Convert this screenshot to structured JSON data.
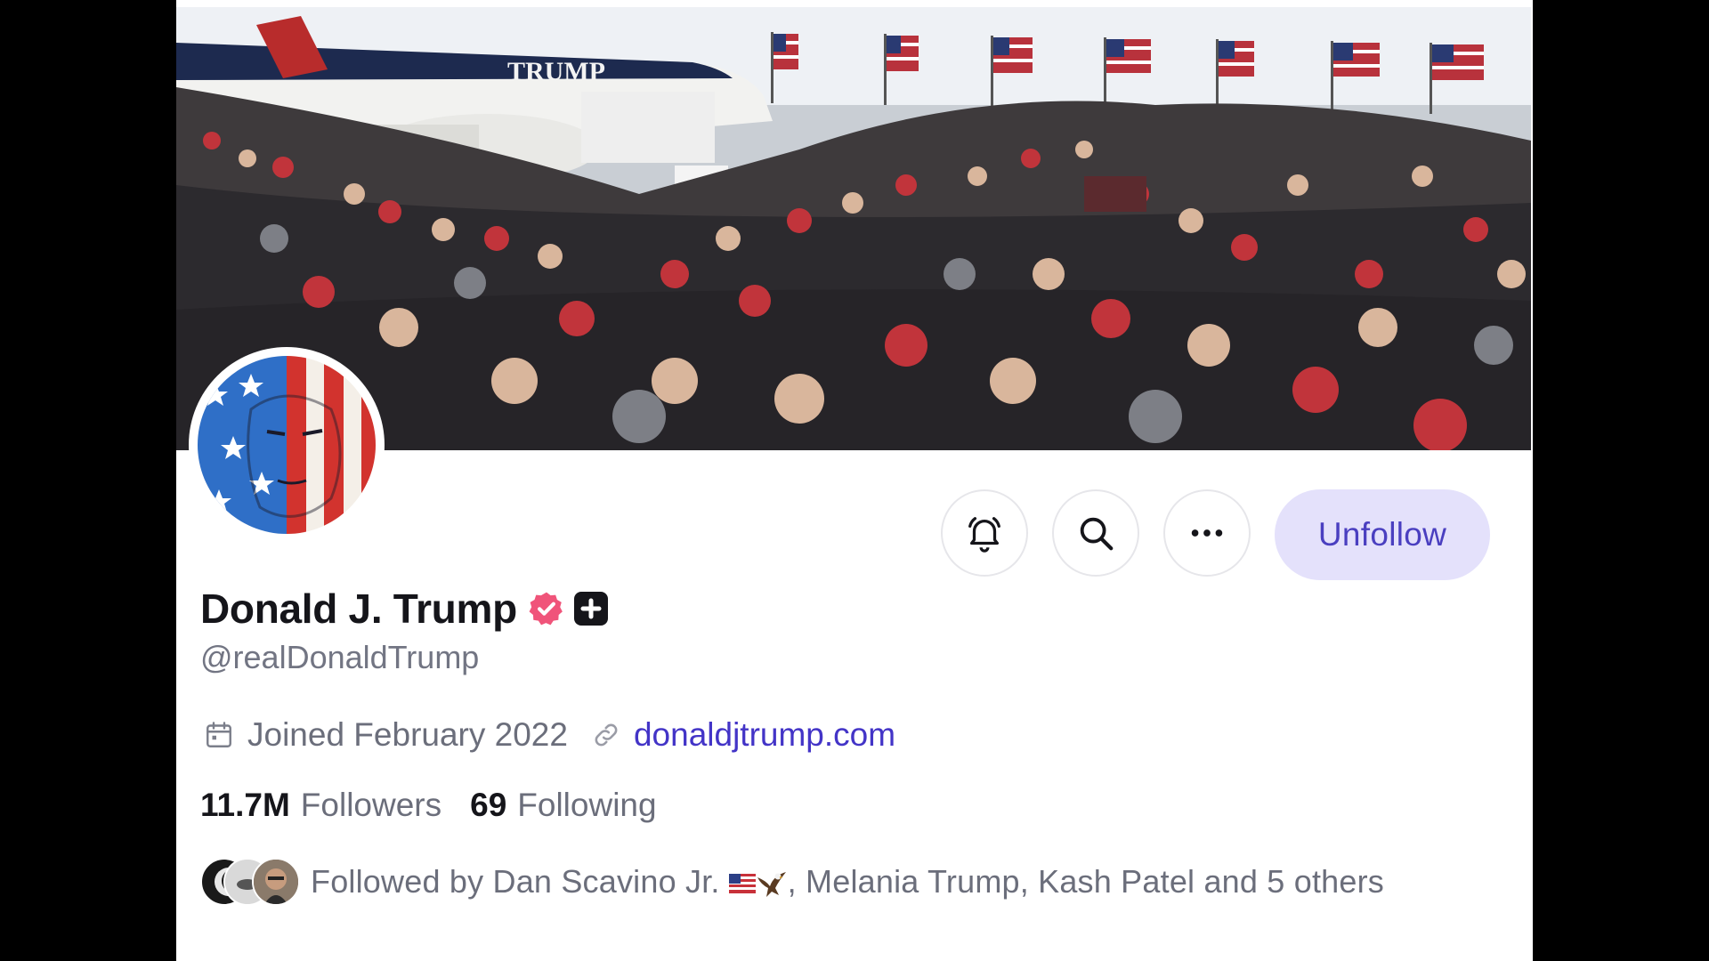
{
  "profile": {
    "display_name": "Donald J. Trump",
    "handle": "@realDonaldTrump",
    "joined": "Joined February 2022",
    "website": "donaldjtrump.com",
    "followers_count": "11.7M",
    "followers_label": "Followers",
    "following_count": "69",
    "following_label": "Following",
    "followed_by": "Followed by Dan Scavino Jr.",
    "followed_by_rest": ", Melania Trump, Kash Patel and 5 others"
  },
  "banner": {
    "plane_lettering": "TRUMP"
  },
  "actions": {
    "unfollow_label": "Unfollow",
    "icons": [
      "bell-icon",
      "search-icon",
      "more-icon"
    ]
  },
  "colors": {
    "accent": "#4334c7",
    "unfollow_bg": "#e4e1fb",
    "verified": "#f0547a",
    "text_primary": "#15151a",
    "text_secondary": "#6b6e7b"
  }
}
